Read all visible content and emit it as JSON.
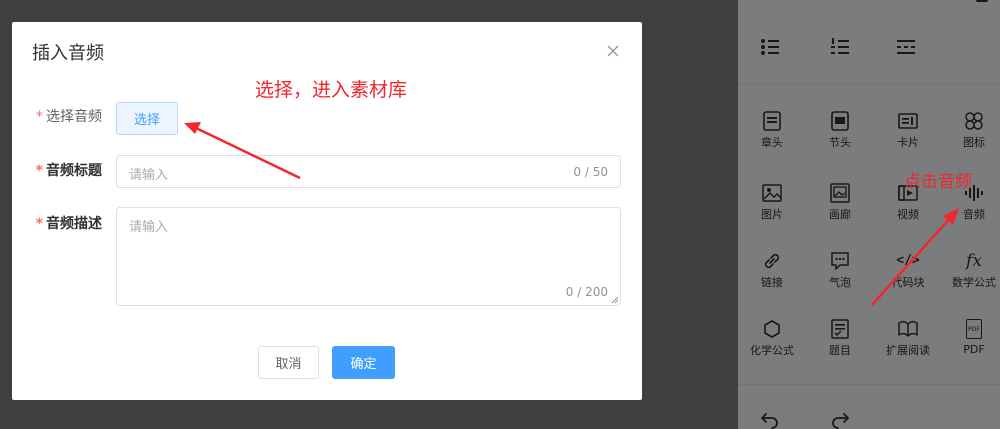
{
  "dialog": {
    "title": "插入音频",
    "close_icon": "close-icon",
    "fields": {
      "audio": {
        "label": "选择音频",
        "button_label": "选择"
      },
      "title": {
        "label": "音频标题",
        "placeholder": "请输入",
        "counter": "0 / 50"
      },
      "description": {
        "label": "音频描述",
        "placeholder": "请输入",
        "counter": "0 / 200"
      }
    },
    "required_mark": "*",
    "buttons": {
      "cancel": "取消",
      "confirm": "确定"
    }
  },
  "annotations": {
    "choose_hint": "选择，进入素材库",
    "click_audio_hint": "点击音频",
    "color": "#f0282d"
  },
  "toolbar": {
    "row1": [
      {
        "icon": "bullet-list-icon"
      },
      {
        "icon": "numbered-list-icon"
      },
      {
        "icon": "align-icon"
      }
    ],
    "items": [
      {
        "label": "章头",
        "icon": "chapter-head-icon"
      },
      {
        "label": "节头",
        "icon": "section-head-icon"
      },
      {
        "label": "卡片",
        "icon": "card-icon"
      },
      {
        "label": "图标",
        "icon": "icon-grid-icon"
      },
      {
        "label": "图片",
        "icon": "image-icon"
      },
      {
        "label": "画廊",
        "icon": "gallery-icon"
      },
      {
        "label": "视频",
        "icon": "video-icon"
      },
      {
        "label": "音频",
        "icon": "audio-icon"
      },
      {
        "label": "链接",
        "icon": "link-icon"
      },
      {
        "label": "气泡",
        "icon": "bubble-icon"
      },
      {
        "label": "代码块",
        "icon": "code-icon"
      },
      {
        "label": "数学公式",
        "icon": "math-formula-icon"
      },
      {
        "label": "化学公式",
        "icon": "chemistry-icon"
      },
      {
        "label": "题目",
        "icon": "question-icon"
      },
      {
        "label": "扩展阅读",
        "icon": "extended-reading-icon"
      },
      {
        "label": "PDF",
        "icon": "pdf-icon"
      }
    ],
    "code_glyph": "</>",
    "math_glyph": "fx",
    "pdf_glyph": "PDF",
    "bottom": [
      {
        "icon": "undo-icon"
      },
      {
        "icon": "redo-icon"
      }
    ]
  }
}
